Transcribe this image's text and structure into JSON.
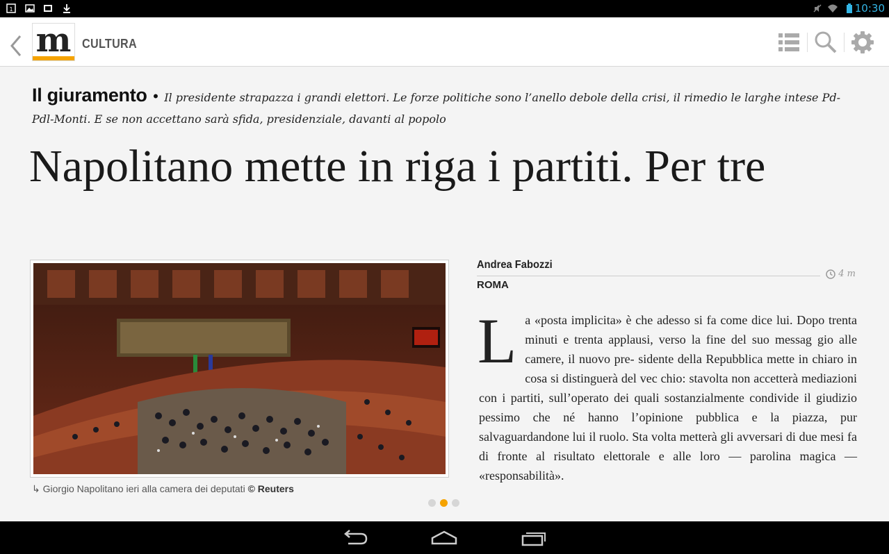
{
  "status_bar": {
    "time": "10:30",
    "left_icons": [
      "tablet-icon",
      "image-icon",
      "film-icon",
      "download-icon"
    ],
    "right_icons": [
      "mute-icon",
      "wifi-icon",
      "battery-icon"
    ]
  },
  "app_bar": {
    "logo_letter": "m",
    "section": "CULTURA",
    "actions": [
      "list-icon",
      "search-icon",
      "gear-icon"
    ]
  },
  "article": {
    "kicker_title": "Il giuramento",
    "kicker_subtitle": "Il presidente strapazza i grandi elettori. Le forze politiche sono l’anello debole della crisi, il rimedio le larghe intese Pd-Pdl-Monti. E se non accettano sarà sfida, presidenziale, davanti al popolo",
    "headline": "Napolitano mette in riga i partiti. Per tre",
    "caption_text": "Giorgio Napolitano ieri alla camera dei deputati",
    "caption_credit": "© Reuters",
    "author": "Andrea Fabozzi",
    "read_time": "4 m",
    "city": "ROMA",
    "dropcap": "L",
    "body": "a «posta implicita» è che adesso si fa come dice lui. Dopo trenta minuti e trenta applausi, verso la fine del suo messag gio alle camere, il nuovo pre- sidente della Repubblica mette in chiaro in cosa si distinguerà del vec chio: stavolta non accetterà mediazioni con i partiti, sull’operato dei quali sostanzialmente condivide il giudizio pessimo che né hanno l’opinione pubblica e la piazza, pur salvaguardandone lui il ruolo. Sta volta metterà gli avversari di due mesi fa di fronte al risultato elettorale e alle loro — parolina magica — «responsabilità».",
    "pagination": {
      "total": 3,
      "current": 2
    }
  },
  "colors": {
    "accent": "#f5a300",
    "status_time": "#33b5e5"
  },
  "nav_bar": [
    "back-icon",
    "home-icon",
    "recent-apps-icon"
  ]
}
